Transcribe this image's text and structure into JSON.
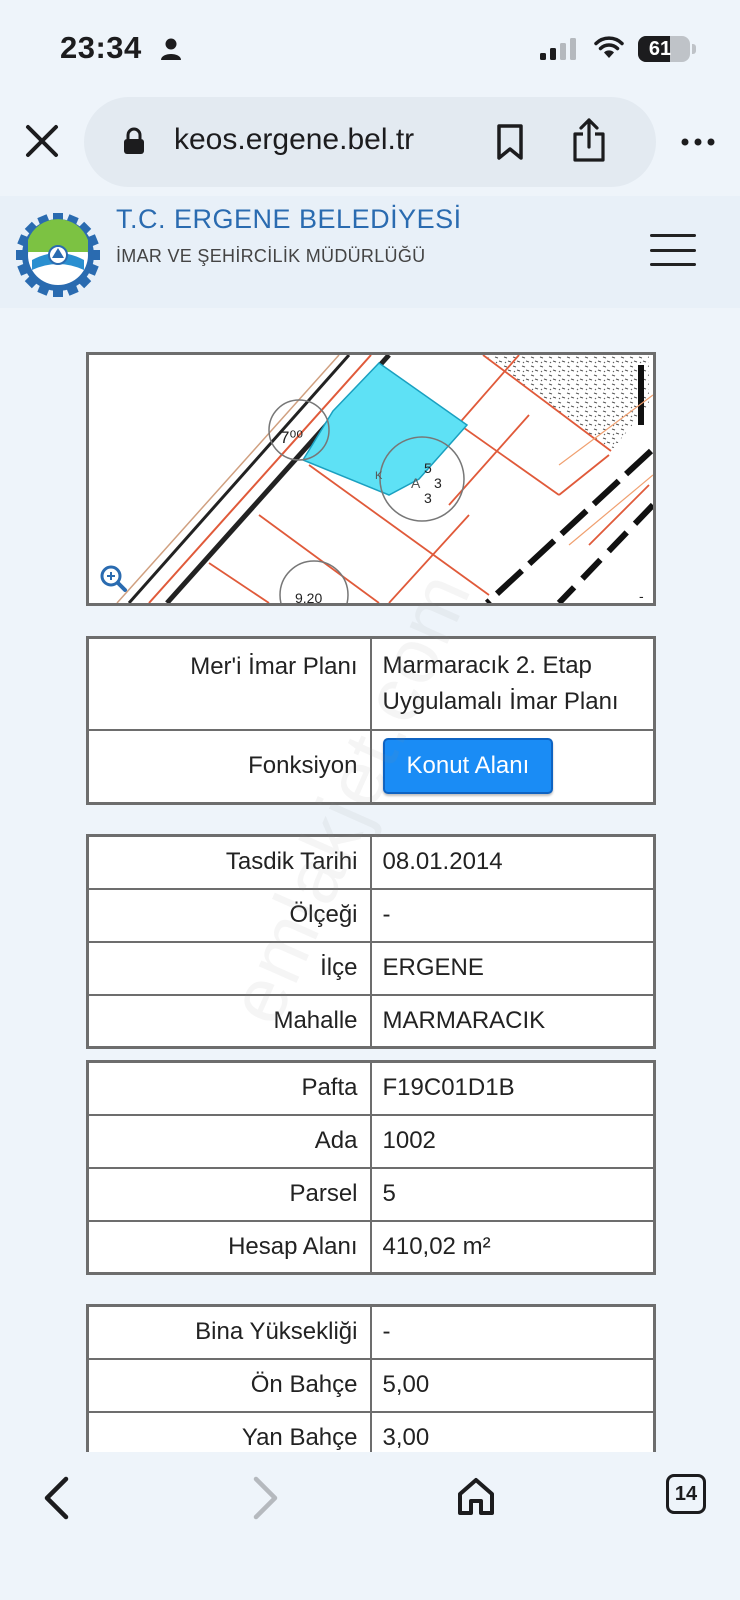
{
  "status_bar": {
    "time": "23:34",
    "battery_level": "61",
    "battery_fraction": 0.61
  },
  "browser": {
    "url": "keos.ergene.bel.tr",
    "tab_count": "14"
  },
  "site": {
    "title": "T.C. ERGENE BELEDİYESİ",
    "subtitle": "İMAR VE ŞEHİRCİLİK MÜDÜRLÜĞÜ"
  },
  "map": {
    "labels": [
      "7⁰⁰",
      "5",
      "3",
      "3",
      "K",
      "A",
      "9.20"
    ]
  },
  "plan_table": {
    "plan_key": "Mer'i İmar Planı",
    "plan_line1": "Marmaracık 2. Etap",
    "plan_line2": "Uygulamalı İmar Planı",
    "function_key": "Fonksiyon",
    "function_value": "Konut Alanı"
  },
  "approval_table": [
    {
      "key": "Tasdik Tarihi",
      "value": "08.01.2014"
    },
    {
      "key": "Ölçeği",
      "value": "-"
    },
    {
      "key": "İlçe",
      "value": "ERGENE"
    },
    {
      "key": "Mahalle",
      "value": "MARMARACIK"
    }
  ],
  "parcel_table": [
    {
      "key": "Pafta",
      "value": "F19C01D1B"
    },
    {
      "key": "Ada",
      "value": "1002"
    },
    {
      "key": "Parsel",
      "value": "5"
    },
    {
      "key": "Hesap Alanı",
      "value": "410,02 m²"
    }
  ],
  "building_table": [
    {
      "key": "Bina Yüksekliği",
      "value": "-"
    },
    {
      "key": "Ön Bahçe",
      "value": "5,00"
    },
    {
      "key": "Yan Bahçe",
      "value": "3,00"
    }
  ],
  "watermark": "emlakjet.com",
  "colors": {
    "accent": "#1a8cf5",
    "title": "#2a6bb0",
    "parcel_fill": "#5ee1f5"
  }
}
